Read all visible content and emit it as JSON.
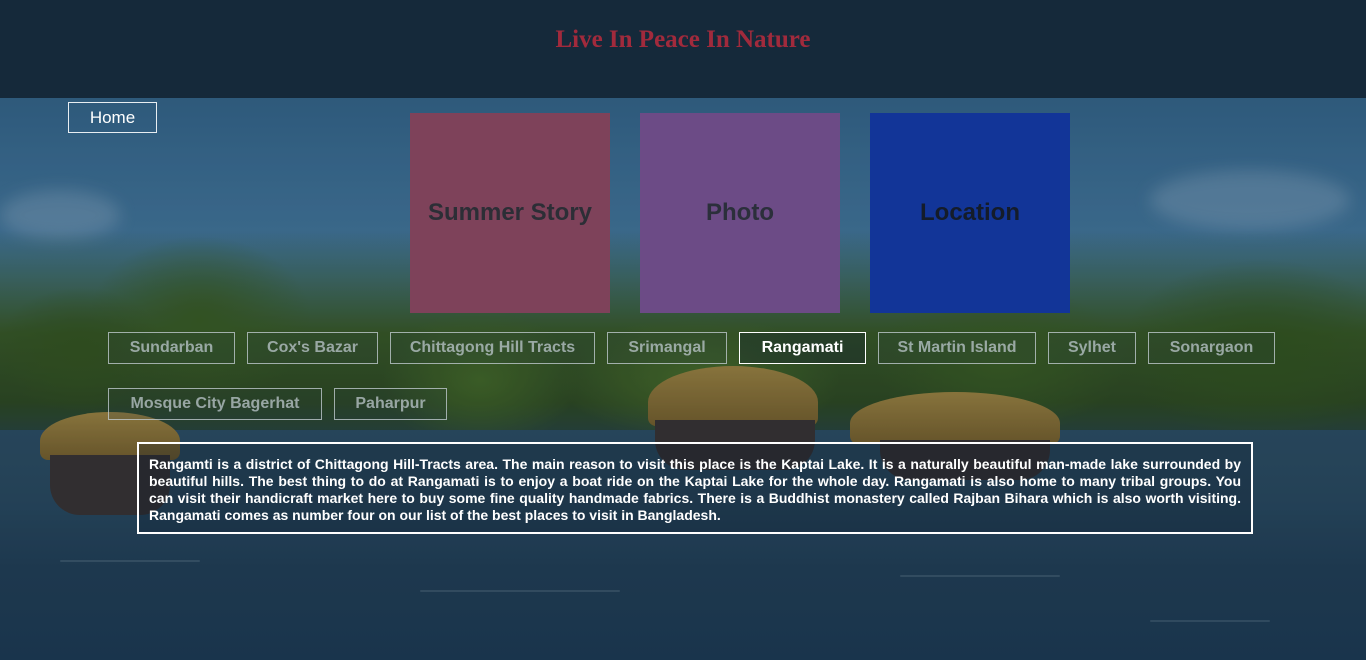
{
  "header": {
    "title": "Live In Peace In Nature"
  },
  "nav": {
    "home_label": "Home"
  },
  "cards": [
    {
      "label": "Summer Story",
      "color": "#7e425a"
    },
    {
      "label": "Photo",
      "color": "#6c4b86"
    },
    {
      "label": "Location",
      "color": "#123598"
    }
  ],
  "places": [
    {
      "label": "Sundarban"
    },
    {
      "label": "Cox's Bazar"
    },
    {
      "label": "Chittagong Hill Tracts"
    },
    {
      "label": "Srimangal"
    },
    {
      "label": "Rangamati",
      "active": true
    },
    {
      "label": "St Martin Island"
    },
    {
      "label": "Sylhet"
    },
    {
      "label": "Sonargaon"
    },
    {
      "label": "Mosque City Bagerhat"
    },
    {
      "label": "Paharpur"
    }
  ],
  "description": "Rangamti is a district of Chittagong Hill-Tracts area. The main reason to visit this place is the Kaptai Lake. It is a naturally beautiful man-made lake surrounded by beautiful hills. The best thing to do at Rangamati is to enjoy a boat ride on the Kaptai Lake for the whole day. Rangamati is also home to many tribal groups. You can visit their handicraft market here to buy some fine quality handmade fabrics. There is a Buddhist monastery called Rajban Bihara which is also worth visiting. Rangamati comes as number four on our list of the best places to visit in Bangladesh.",
  "colors": {
    "header_bg": "#15293a",
    "title": "#a12a3c",
    "active_tab": "#ffffff"
  }
}
